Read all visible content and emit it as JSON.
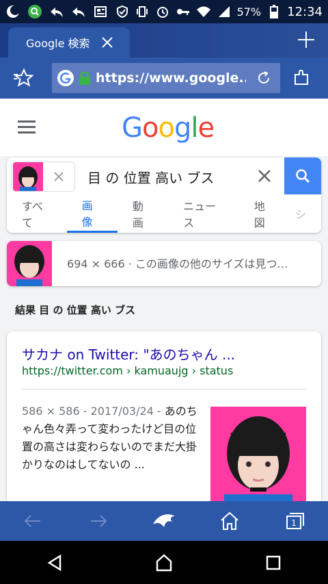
{
  "status": {
    "battery": "57%",
    "time": "12:34"
  },
  "browser": {
    "tab_title": "Google 検索",
    "url": "https://www.google...."
  },
  "google": {
    "query": "目 の 位置 高い ブス",
    "tabs": [
      "すべて",
      "画像",
      "動画",
      "ニュース",
      "地図",
      "シ"
    ],
    "active_tab": "画像",
    "image_info": "694 × 666 · この画像の他のサイズは見つ…",
    "results_heading": "結果 目 の 位置 高い ブス",
    "result": {
      "title": "サカナ on Twitter: \"あのちゃん ...",
      "url": "https://twitter.com › kamuaujg › status",
      "meta": "586 × 586 - 2017/03/24 - ",
      "snippet": "あのちゃん色々弄って変わったけど目の位置の高さは変わらないのでまだ大掛かりなのはしてないの ..."
    }
  },
  "colors": {
    "accent": "#1a73e8",
    "browser_blue": "#2d58a8",
    "pink": "#ff3aa0"
  }
}
